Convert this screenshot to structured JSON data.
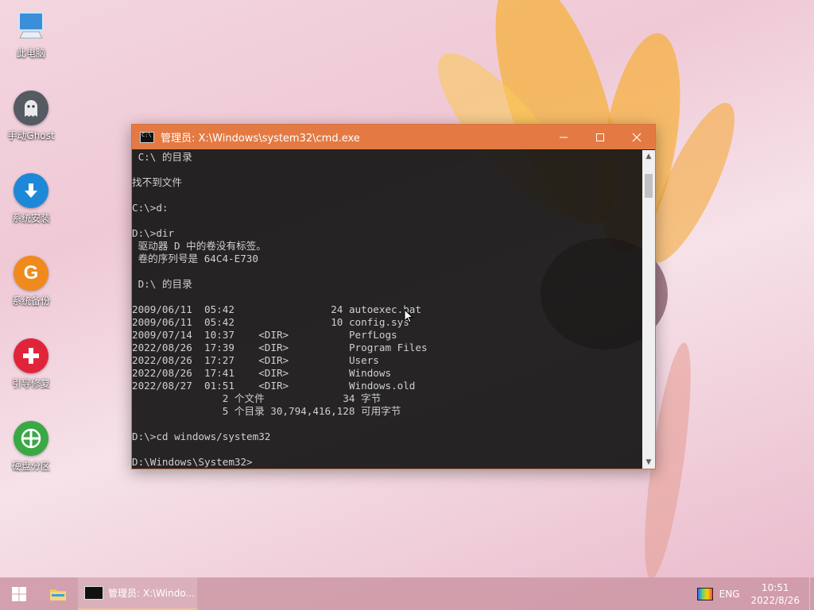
{
  "desktop": {
    "icons": [
      {
        "label": "此电脑",
        "icon": "computer-icon"
      },
      {
        "label": "手动Ghost",
        "icon": "ghost-icon"
      },
      {
        "label": "系统安装",
        "icon": "download-icon"
      },
      {
        "label": "系统备份",
        "icon": "backup-g-icon"
      },
      {
        "label": "引导修复",
        "icon": "plus-cross-icon"
      },
      {
        "label": "硬盘分区",
        "icon": "partition-icon"
      }
    ]
  },
  "cmd_window": {
    "title": "管理员: X:\\Windows\\system32\\cmd.exe",
    "titlebar_color": "#e47a43",
    "lines": [
      " C:\\ 的目录",
      "",
      "找不到文件",
      "",
      "C:\\>d:",
      "",
      "D:\\>dir",
      " 驱动器 D 中的卷没有标签。",
      " 卷的序列号是 64C4-E730",
      "",
      " D:\\ 的目录",
      "",
      "2009/06/11  05:42                24 autoexec.bat",
      "2009/06/11  05:42                10 config.sys",
      "2009/07/14  10:37    <DIR>          PerfLogs",
      "2022/08/26  17:39    <DIR>          Program Files",
      "2022/08/26  17:27    <DIR>          Users",
      "2022/08/26  17:41    <DIR>          Windows",
      "2022/08/27  01:51    <DIR>          Windows.old",
      "               2 个文件             34 字节",
      "               5 个目录 30,794,416,128 可用字节",
      "",
      "D:\\>cd windows/system32",
      "",
      "D:\\Windows\\System32>"
    ]
  },
  "taskbar": {
    "task_label": "管理员: X:\\Windo...",
    "language": "ENG",
    "time": "10:51",
    "date": "2022/8/26"
  }
}
